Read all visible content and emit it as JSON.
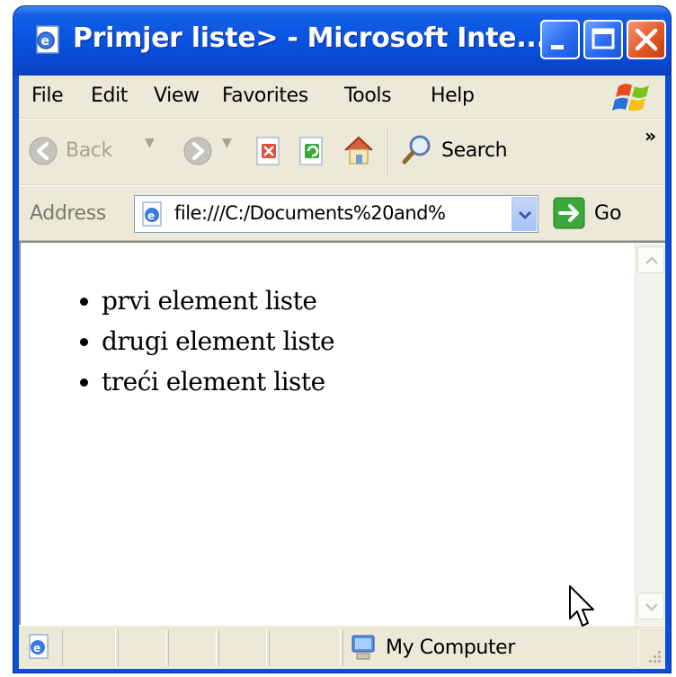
{
  "window": {
    "title": "Primjer liste> - Microsoft Inte...",
    "title_icon": "ie-page-icon",
    "controls": [
      "minimize",
      "maximize",
      "close"
    ]
  },
  "menu": {
    "items": [
      "File",
      "Edit",
      "View",
      "Favorites",
      "Tools",
      "Help"
    ]
  },
  "toolbar": {
    "back_label": "Back",
    "search_label": "Search",
    "more_glyph": "»"
  },
  "address": {
    "label": "Address",
    "value": "file:///C:/Documents%20and%",
    "go_label": "Go"
  },
  "page": {
    "list_items": [
      "prvi element liste",
      "drugi element liste",
      "treći element liste"
    ]
  },
  "status": {
    "zone_label": "My Computer"
  },
  "colors": {
    "titlebar": "#0a54e0",
    "chrome": "#ece9d8",
    "close_button": "#e25a2a"
  }
}
